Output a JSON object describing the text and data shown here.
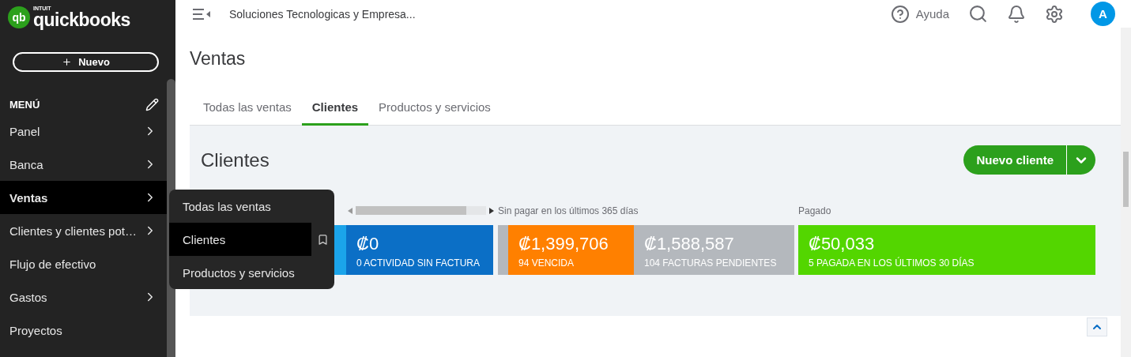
{
  "logo": {
    "vendor": "INTUIT",
    "brand": "quickbooks",
    "mark": "qb"
  },
  "new_button": {
    "label": "Nuevo"
  },
  "menu": {
    "title": "MENÚ",
    "items": [
      {
        "label": "Panel",
        "selected": false,
        "has_submenu": true
      },
      {
        "label": "Banca",
        "selected": false,
        "has_submenu": true
      },
      {
        "label": "Ventas",
        "selected": true,
        "has_submenu": true
      },
      {
        "label": "Clientes y clientes pot…",
        "selected": false,
        "has_submenu": true
      },
      {
        "label": "Flujo de efectivo",
        "selected": false,
        "has_submenu": false
      },
      {
        "label": "Gastos",
        "selected": false,
        "has_submenu": true
      },
      {
        "label": "Proyectos",
        "selected": false,
        "has_submenu": false
      }
    ]
  },
  "flyout": {
    "items": [
      {
        "label": "Todas las ventas",
        "selected": false
      },
      {
        "label": "Clientes",
        "selected": true
      },
      {
        "label": "Productos y servicios",
        "selected": false
      }
    ]
  },
  "topbar": {
    "company": "Soluciones Tecnologicas y Empresa...",
    "help": "Ayuda",
    "avatar": "A"
  },
  "page_title": "Ventas",
  "tabs": [
    {
      "label": "Todas las ventas",
      "selected": false
    },
    {
      "label": "Clientes",
      "selected": true
    },
    {
      "label": "Productos y servicios",
      "selected": false
    }
  ],
  "section": {
    "title": "Clientes",
    "new_customer_button": "Nuevo cliente"
  },
  "money_bar": {
    "unpaid_label": "Sin pagar en los últimos 365 días",
    "paid_label": "Pagado",
    "segments": [
      {
        "color": "#1ba4ea"
      },
      {
        "amount": "₡0",
        "caption": "0 ACTIVIDAD SIN FACTURA",
        "color": "#0b6fc6"
      },
      {
        "color": "#b4b8bd"
      },
      {
        "amount": "₡1,399,706",
        "caption": "94 VENCIDA",
        "color": "#ff8000"
      },
      {
        "amount": "₡1,588,587",
        "caption": "104 FACTURAS PENDIENTES",
        "color": "#b4b8bd"
      },
      {
        "amount": "₡50,033",
        "caption": "5 PAGADA EN LOS ÚLTIMOS 30 DÍAS",
        "color": "#53d600"
      }
    ]
  }
}
